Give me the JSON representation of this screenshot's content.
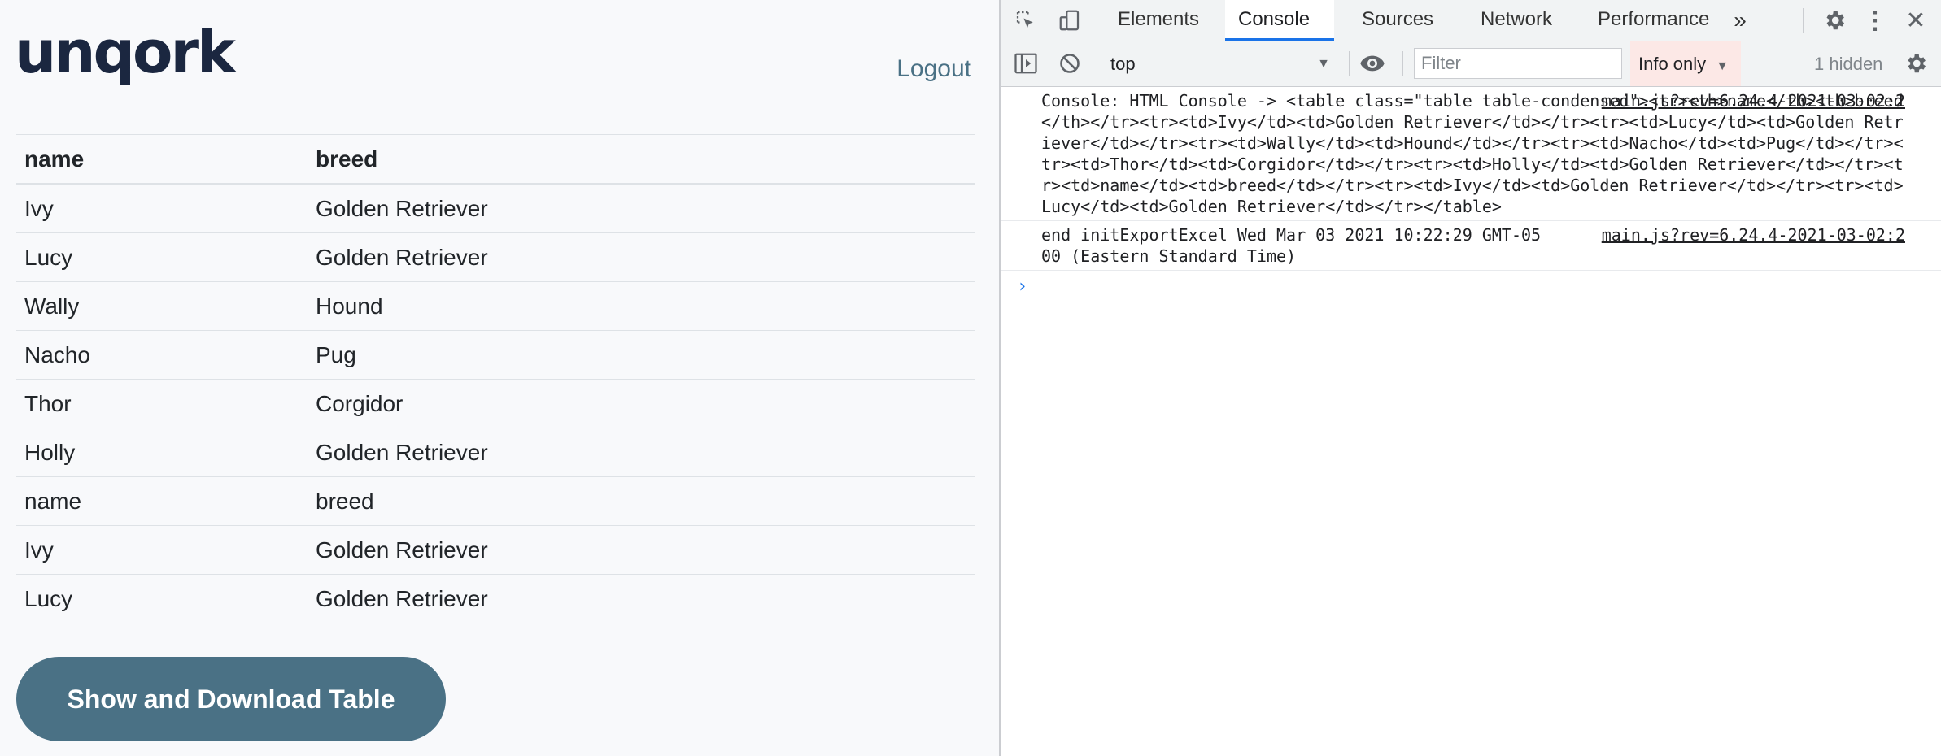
{
  "app": {
    "logo": "unqork",
    "logout_label": "Logout",
    "table": {
      "headers": [
        "name",
        "breed"
      ],
      "rows": [
        [
          "Ivy",
          "Golden Retriever"
        ],
        [
          "Lucy",
          "Golden Retriever"
        ],
        [
          "Wally",
          "Hound"
        ],
        [
          "Nacho",
          "Pug"
        ],
        [
          "Thor",
          "Corgidor"
        ],
        [
          "Holly",
          "Golden Retriever"
        ],
        [
          "name",
          "breed"
        ],
        [
          "Ivy",
          "Golden Retriever"
        ],
        [
          "Lucy",
          "Golden Retriever"
        ]
      ]
    },
    "show_button_label": "Show and Download Table"
  },
  "devtools": {
    "tabs": [
      "Elements",
      "Console",
      "Sources",
      "Network",
      "Performance"
    ],
    "active_tab": "Console",
    "more_tabs_icon": "double-chevron-right-icon",
    "context": "top",
    "filter_placeholder": "Filter",
    "levels_label": "Info only",
    "hidden_label": "1 hidden",
    "messages": [
      {
        "text": "Console: HTML Console -> <table class=\"table table-condensed\"><tr><th>name</th><th>breed</th></tr><tr><td>Ivy</td><td>Golden Retriever</td></tr><tr><td>Lucy</td><td>Golden Retriever</td></tr><tr><td>Wally</td><td>Hound</td></tr><tr><td>Nacho</td><td>Pug</td></tr><tr><td>Thor</td><td>Corgidor</td></tr><tr><td>Holly</td><td>Golden Retriever</td></tr><tr><td>name</td><td>breed</td></tr><tr><td>Ivy</td><td>Golden Retriever</td></tr><tr><td>Lucy</td><td>Golden Retriever</td></tr></table>",
        "source": "main.js?rev=6.24.4-2021-03-02:2"
      },
      {
        "text": "end initExportExcel Wed Mar 03 2021 10:22:29 GMT-0500 (Eastern Standard Time)",
        "source": "main.js?rev=6.24.4-2021-03-02:2"
      }
    ],
    "prompt_symbol": "›"
  },
  "colors": {
    "brand": "#1b2740",
    "accent": "#4a7185",
    "devtools_active": "#1a73e8",
    "levels_bg": "#fce8e6"
  }
}
